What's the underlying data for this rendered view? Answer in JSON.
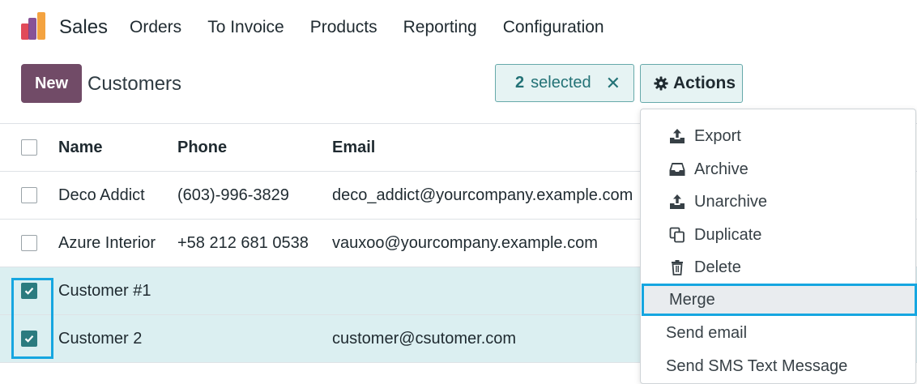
{
  "navbar": {
    "app_name": "Sales",
    "menu": [
      "Orders",
      "To Invoice",
      "Products",
      "Reporting",
      "Configuration"
    ]
  },
  "control": {
    "new_label": "New",
    "title": "Customers",
    "selected_count": "2",
    "selected_label": "selected",
    "close_glyph": "✕",
    "actions_label": "Actions"
  },
  "table": {
    "headers": [
      "Name",
      "Phone",
      "Email"
    ],
    "rows": [
      {
        "name": "Deco Addict",
        "phone": "(603)-996-3829",
        "email": "deco_addict@yourcompany.example.com",
        "checked": false
      },
      {
        "name": "Azure Interior",
        "phone": "+58 212 681 0538",
        "email": "vauxoo@yourcompany.example.com",
        "checked": false
      },
      {
        "name": "Customer #1",
        "phone": "",
        "email": "",
        "checked": true
      },
      {
        "name": "Customer 2",
        "phone": "",
        "email": "customer@csutomer.com",
        "checked": true
      }
    ]
  },
  "actions_menu": {
    "items": [
      {
        "label": "Export",
        "icon": "upload-icon"
      },
      {
        "label": "Archive",
        "icon": "inbox-icon"
      },
      {
        "label": "Unarchive",
        "icon": "upload-icon"
      },
      {
        "label": "Duplicate",
        "icon": "copy-icon"
      },
      {
        "label": "Delete",
        "icon": "trash-icon"
      },
      {
        "label": "Merge",
        "icon": ""
      },
      {
        "label": "Send email",
        "icon": ""
      },
      {
        "label": "Send SMS Text Message",
        "icon": ""
      }
    ],
    "highlighted": "Merge"
  },
  "colors": {
    "brand": "#714b67",
    "selection_bg": "#dbeff1",
    "accent_teal": "#237276",
    "highlight_border": "#16a6e0"
  }
}
